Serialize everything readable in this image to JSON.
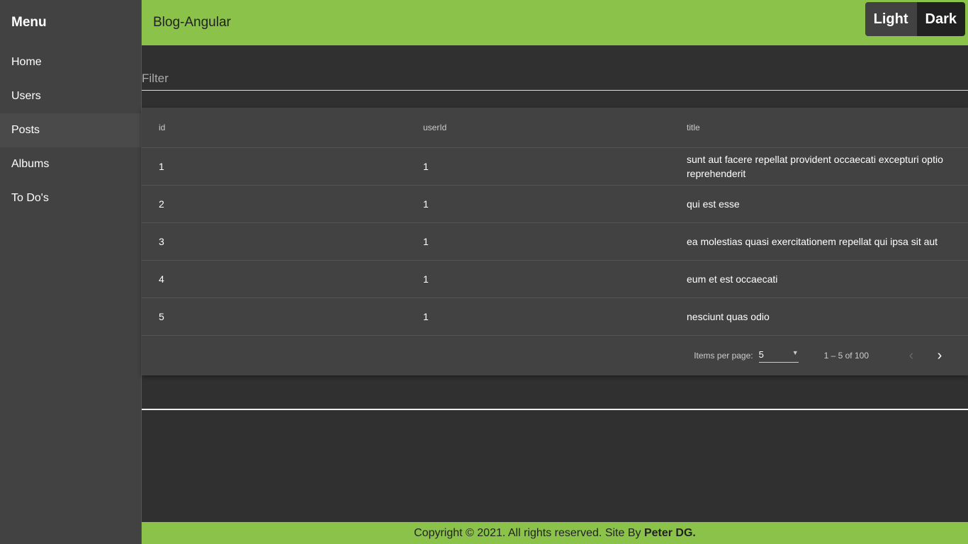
{
  "sidebar": {
    "title": "Menu",
    "items": [
      {
        "label": "Home"
      },
      {
        "label": "Users"
      },
      {
        "label": "Posts"
      },
      {
        "label": "Albums"
      },
      {
        "label": "To Do's"
      }
    ],
    "active": "Posts"
  },
  "header": {
    "title": "Blog-Angular",
    "theme_light": "Light",
    "theme_dark": "Dark"
  },
  "filter": {
    "placeholder": "Filter"
  },
  "table": {
    "columns": [
      "id",
      "userId",
      "title"
    ],
    "rows": [
      [
        "1",
        "1",
        "sunt aut facere repellat provident occaecati excepturi optio reprehenderit"
      ],
      [
        "2",
        "1",
        "qui est esse"
      ],
      [
        "3",
        "1",
        "ea molestias quasi exercitationem repellat qui ipsa sit aut"
      ],
      [
        "4",
        "1",
        "eum et est occaecati"
      ],
      [
        "5",
        "1",
        "nesciunt quas odio"
      ]
    ]
  },
  "paginator": {
    "items_per_page_label": "Items per page:",
    "page_size": "5",
    "range": "1 – 5 of 100"
  },
  "footer": {
    "text": "Copyright © 2021. All rights reserved. Site By ",
    "author": "Peter DG."
  },
  "colors": {
    "accent": "#8bc34a",
    "background": "#303030",
    "surface": "#424242"
  }
}
